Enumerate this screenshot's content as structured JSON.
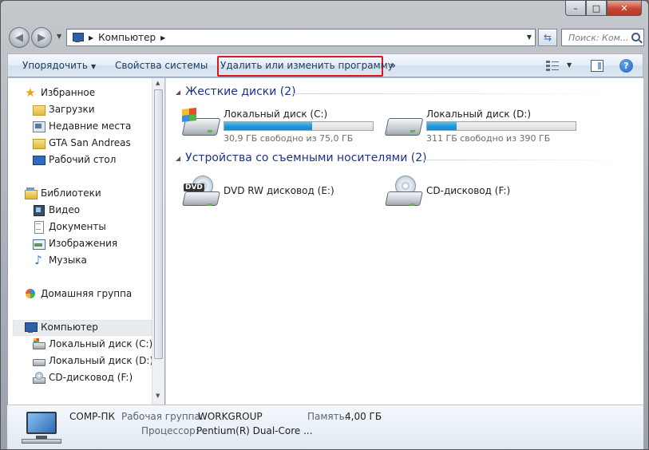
{
  "window": {
    "caption_buttons": {
      "minimize": "–",
      "maximize": "□",
      "close": "✕"
    }
  },
  "address": {
    "crumb": "Компьютер",
    "search_placeholder": "Поиск: Ком..."
  },
  "toolbar": {
    "organize": "Упорядочить",
    "system_properties": "Свойства системы",
    "uninstall": "Удалить или изменить программу",
    "more": "»",
    "highlight_color": "#e0141b"
  },
  "sidebar": {
    "favorites": "Избранное",
    "downloads": "Загрузки",
    "recent": "Недавние места",
    "gta": "GTA San Andreas",
    "desktop": "Рабочий стол",
    "libraries": "Библиотеки",
    "video": "Видео",
    "documents": "Документы",
    "images": "Изображения",
    "music": "Музыка",
    "homegroup": "Домашняя группа",
    "computer": "Компьютер",
    "disk_c": "Локальный диск (C:)",
    "disk_d": "Локальный диск (D:)",
    "cd_f": "CD-дисковод (F:)"
  },
  "content": {
    "hdd_group": "Жесткие диски (2)",
    "removable_group": "Устройства со съемными носителями (2)",
    "drives": [
      {
        "name": "Локальный диск (C:)",
        "free": "30,9 ГБ свободно из 75,0 ГБ",
        "used_fraction": 0.59
      },
      {
        "name": "Локальный диск (D:)",
        "free": "311 ГБ свободно из 390 ГБ",
        "used_fraction": 0.2
      }
    ],
    "removable": [
      {
        "name": "DVD RW дисковод (E:)",
        "badge": "DVD"
      },
      {
        "name": "CD-дисковод (F:)"
      }
    ]
  },
  "details": {
    "pc_name": "COMP-ПК",
    "workgroup_label": "Рабочая группа:",
    "workgroup_value": "WORKGROUP",
    "memory_label": "Память:",
    "memory_value": "4,00 ГБ",
    "cpu_label": "Процессор:",
    "cpu_value": "Pentium(R) Dual-Core  ..."
  }
}
